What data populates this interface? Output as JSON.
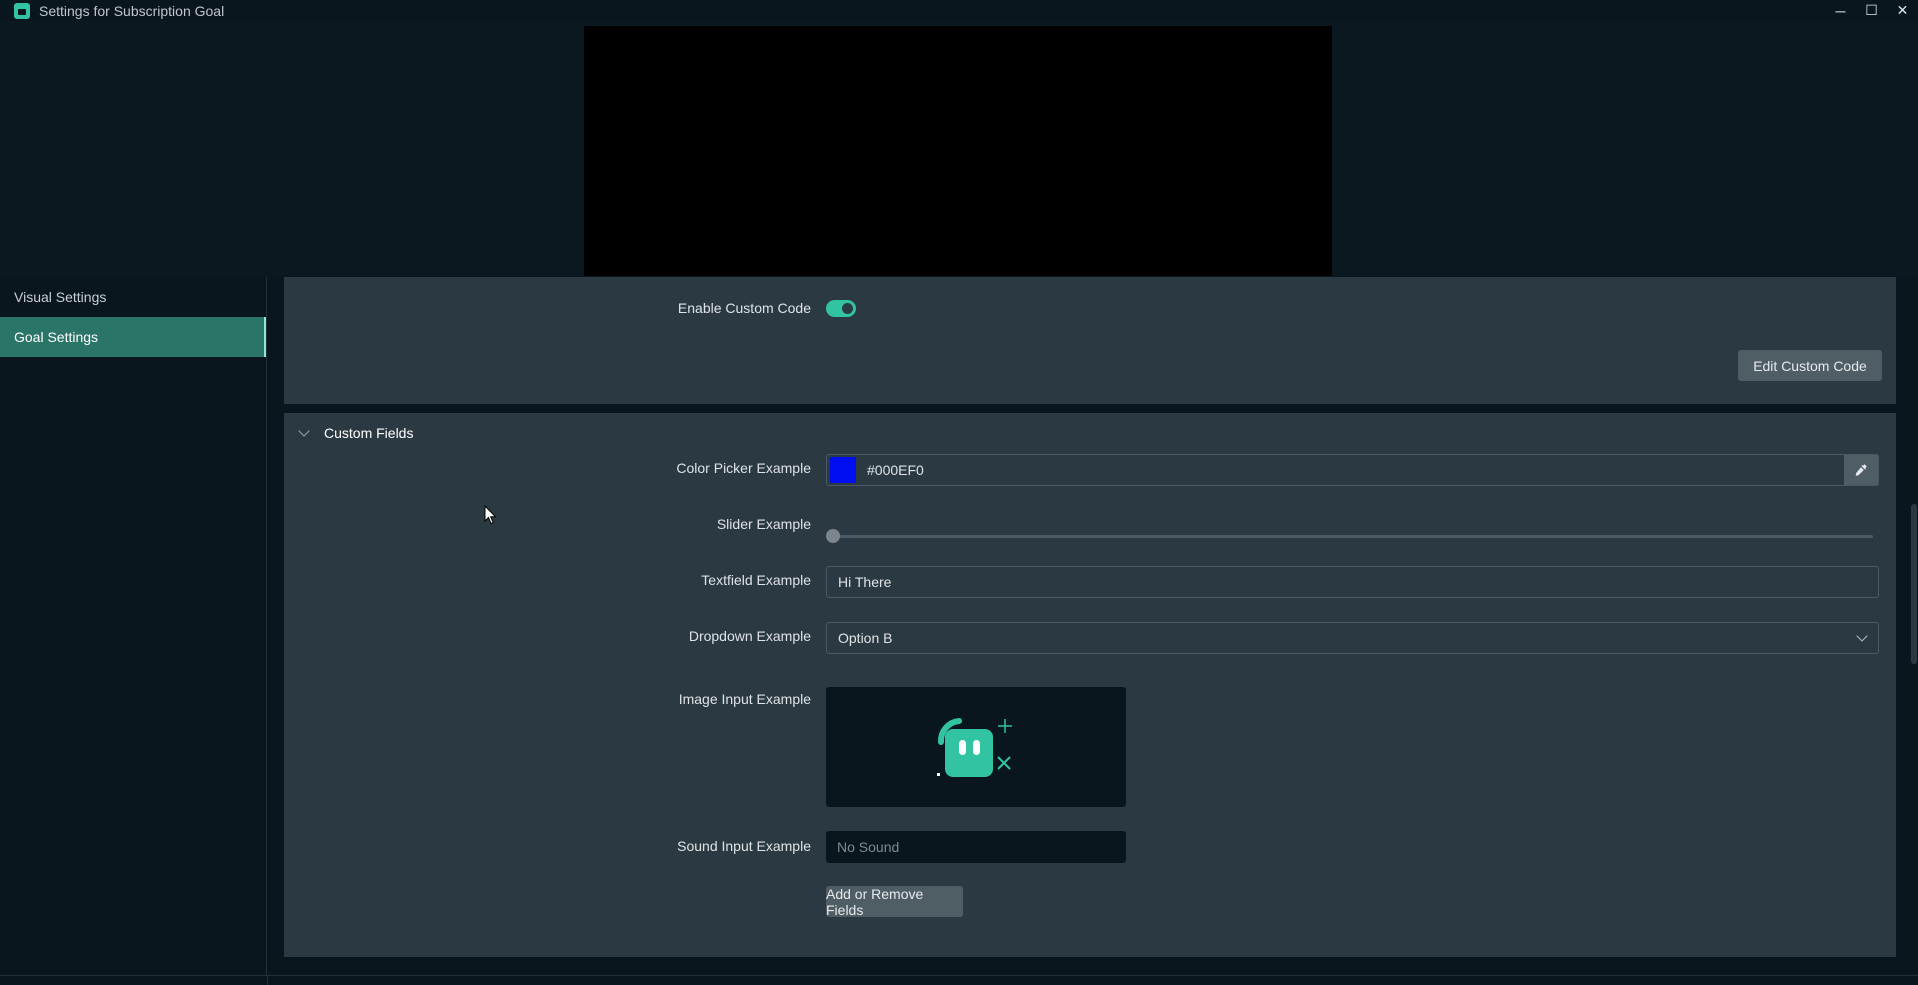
{
  "window": {
    "title": "Settings for Subscription Goal",
    "controls": {
      "minimize": "─",
      "maximize": "☐",
      "close": "✕"
    }
  },
  "sidebar": {
    "items": [
      {
        "label": "Visual Settings",
        "active": false
      },
      {
        "label": "Goal Settings",
        "active": true
      }
    ]
  },
  "custom_code": {
    "enable_label": "Enable Custom Code",
    "enabled": true,
    "edit_button": "Edit Custom Code"
  },
  "custom_fields": {
    "section_title": "Custom Fields",
    "color_picker": {
      "label": "Color Picker Example",
      "value": "#000EF0",
      "swatch_color": "#000ef0"
    },
    "slider": {
      "label": "Slider Example",
      "value": 0
    },
    "textfield": {
      "label": "Textfield Example",
      "value": "Hi There"
    },
    "dropdown": {
      "label": "Dropdown Example",
      "selected": "Option B"
    },
    "image_input": {
      "label": "Image Input Example",
      "icon": "robot-mascot-icon"
    },
    "sound_input": {
      "label": "Sound Input Example",
      "placeholder": "No Sound"
    },
    "add_remove_button": "Add or Remove Fields"
  },
  "colors": {
    "accent": "#31c3a2",
    "active_nav": "#2b7468",
    "panel": "#2b3a42",
    "background": "#09161d"
  }
}
